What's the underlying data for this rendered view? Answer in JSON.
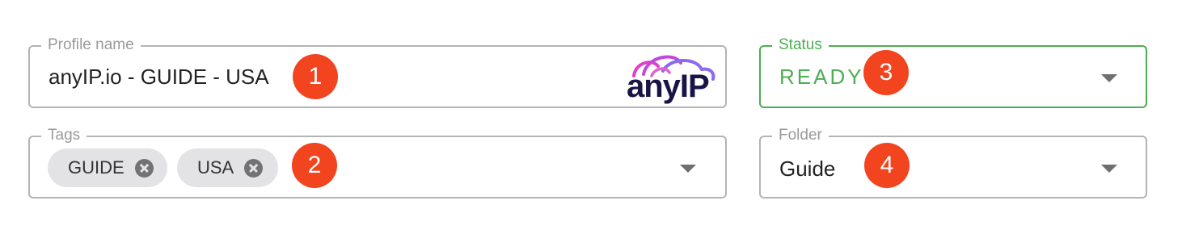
{
  "profile_name": {
    "label": "Profile name",
    "value": "anyIP.io - GUIDE - USA",
    "badge": "1",
    "logo": {
      "text": "anyIP",
      "icon": "anyip-logo-icon",
      "text_color": "#1a1446",
      "wave_colors": [
        "#e040c8",
        "#b060e8",
        "#7a6cf0"
      ]
    }
  },
  "tags": {
    "label": "Tags",
    "chips": [
      {
        "label": "GUIDE",
        "remove_icon": "cancel-circle-icon"
      },
      {
        "label": "USA",
        "remove_icon": "cancel-circle-icon"
      }
    ],
    "badge": "2",
    "dropdown_icon": "chevron-down-icon"
  },
  "status": {
    "label": "Status",
    "value": "READY",
    "badge": "3",
    "color": "#4caf50",
    "dropdown_icon": "chevron-down-icon"
  },
  "folder": {
    "label": "Folder",
    "value": "Guide",
    "badge": "4",
    "dropdown_icon": "chevron-down-icon"
  },
  "colors": {
    "badge": "#f1441f",
    "border": "#b4b4b4",
    "chip_bg": "#e3e3e6"
  }
}
